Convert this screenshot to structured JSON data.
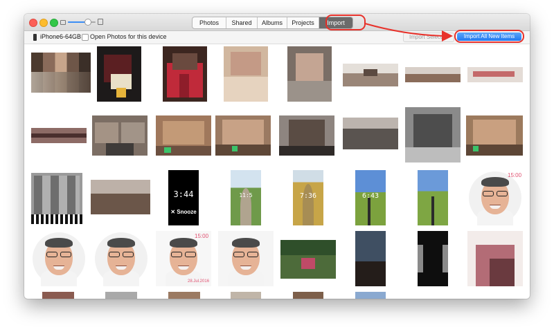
{
  "window": {
    "tabs": [
      {
        "label": "Photos",
        "active": false
      },
      {
        "label": "Shared",
        "active": false
      },
      {
        "label": "Albums",
        "active": false
      },
      {
        "label": "Projects",
        "active": false
      },
      {
        "label": "Import",
        "active": true
      }
    ],
    "zoom_level": 0.7
  },
  "toolbar": {
    "device_name": "iPhone6-64GB",
    "open_photos_label": "Open Photos for this device",
    "open_photos_checked": false,
    "import_selected_label": "Import Selected",
    "import_all_label": "Import All New Items"
  },
  "photos": {
    "lock_screen_time": "3:44",
    "snooze_label": "✕ Snooze",
    "road_photo_1_time": "11:5",
    "road_photo_2_time": "7:36",
    "road_photo_3_time": "6:43",
    "portrait_stamp_time": "15:00",
    "portrait_stamp_date": "28.Jul.2016"
  },
  "annotation": {
    "highlight_color": "#e8312a",
    "accent_color": "#2279f0"
  }
}
